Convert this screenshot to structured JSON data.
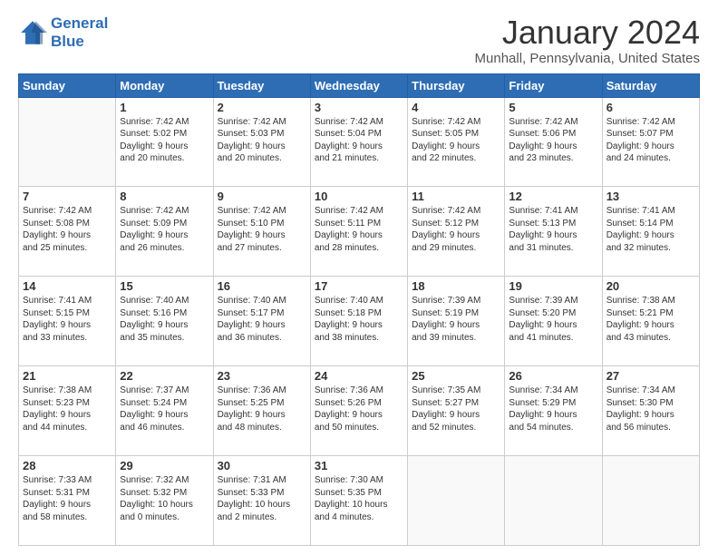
{
  "logo": {
    "line1": "General",
    "line2": "Blue"
  },
  "title": "January 2024",
  "subtitle": "Munhall, Pennsylvania, United States",
  "headers": [
    "Sunday",
    "Monday",
    "Tuesday",
    "Wednesday",
    "Thursday",
    "Friday",
    "Saturday"
  ],
  "weeks": [
    [
      {
        "day": "",
        "lines": []
      },
      {
        "day": "1",
        "lines": [
          "Sunrise: 7:42 AM",
          "Sunset: 5:02 PM",
          "Daylight: 9 hours",
          "and 20 minutes."
        ]
      },
      {
        "day": "2",
        "lines": [
          "Sunrise: 7:42 AM",
          "Sunset: 5:03 PM",
          "Daylight: 9 hours",
          "and 20 minutes."
        ]
      },
      {
        "day": "3",
        "lines": [
          "Sunrise: 7:42 AM",
          "Sunset: 5:04 PM",
          "Daylight: 9 hours",
          "and 21 minutes."
        ]
      },
      {
        "day": "4",
        "lines": [
          "Sunrise: 7:42 AM",
          "Sunset: 5:05 PM",
          "Daylight: 9 hours",
          "and 22 minutes."
        ]
      },
      {
        "day": "5",
        "lines": [
          "Sunrise: 7:42 AM",
          "Sunset: 5:06 PM",
          "Daylight: 9 hours",
          "and 23 minutes."
        ]
      },
      {
        "day": "6",
        "lines": [
          "Sunrise: 7:42 AM",
          "Sunset: 5:07 PM",
          "Daylight: 9 hours",
          "and 24 minutes."
        ]
      }
    ],
    [
      {
        "day": "7",
        "lines": [
          "Sunrise: 7:42 AM",
          "Sunset: 5:08 PM",
          "Daylight: 9 hours",
          "and 25 minutes."
        ]
      },
      {
        "day": "8",
        "lines": [
          "Sunrise: 7:42 AM",
          "Sunset: 5:09 PM",
          "Daylight: 9 hours",
          "and 26 minutes."
        ]
      },
      {
        "day": "9",
        "lines": [
          "Sunrise: 7:42 AM",
          "Sunset: 5:10 PM",
          "Daylight: 9 hours",
          "and 27 minutes."
        ]
      },
      {
        "day": "10",
        "lines": [
          "Sunrise: 7:42 AM",
          "Sunset: 5:11 PM",
          "Daylight: 9 hours",
          "and 28 minutes."
        ]
      },
      {
        "day": "11",
        "lines": [
          "Sunrise: 7:42 AM",
          "Sunset: 5:12 PM",
          "Daylight: 9 hours",
          "and 29 minutes."
        ]
      },
      {
        "day": "12",
        "lines": [
          "Sunrise: 7:41 AM",
          "Sunset: 5:13 PM",
          "Daylight: 9 hours",
          "and 31 minutes."
        ]
      },
      {
        "day": "13",
        "lines": [
          "Sunrise: 7:41 AM",
          "Sunset: 5:14 PM",
          "Daylight: 9 hours",
          "and 32 minutes."
        ]
      }
    ],
    [
      {
        "day": "14",
        "lines": [
          "Sunrise: 7:41 AM",
          "Sunset: 5:15 PM",
          "Daylight: 9 hours",
          "and 33 minutes."
        ]
      },
      {
        "day": "15",
        "lines": [
          "Sunrise: 7:40 AM",
          "Sunset: 5:16 PM",
          "Daylight: 9 hours",
          "and 35 minutes."
        ]
      },
      {
        "day": "16",
        "lines": [
          "Sunrise: 7:40 AM",
          "Sunset: 5:17 PM",
          "Daylight: 9 hours",
          "and 36 minutes."
        ]
      },
      {
        "day": "17",
        "lines": [
          "Sunrise: 7:40 AM",
          "Sunset: 5:18 PM",
          "Daylight: 9 hours",
          "and 38 minutes."
        ]
      },
      {
        "day": "18",
        "lines": [
          "Sunrise: 7:39 AM",
          "Sunset: 5:19 PM",
          "Daylight: 9 hours",
          "and 39 minutes."
        ]
      },
      {
        "day": "19",
        "lines": [
          "Sunrise: 7:39 AM",
          "Sunset: 5:20 PM",
          "Daylight: 9 hours",
          "and 41 minutes."
        ]
      },
      {
        "day": "20",
        "lines": [
          "Sunrise: 7:38 AM",
          "Sunset: 5:21 PM",
          "Daylight: 9 hours",
          "and 43 minutes."
        ]
      }
    ],
    [
      {
        "day": "21",
        "lines": [
          "Sunrise: 7:38 AM",
          "Sunset: 5:23 PM",
          "Daylight: 9 hours",
          "and 44 minutes."
        ]
      },
      {
        "day": "22",
        "lines": [
          "Sunrise: 7:37 AM",
          "Sunset: 5:24 PM",
          "Daylight: 9 hours",
          "and 46 minutes."
        ]
      },
      {
        "day": "23",
        "lines": [
          "Sunrise: 7:36 AM",
          "Sunset: 5:25 PM",
          "Daylight: 9 hours",
          "and 48 minutes."
        ]
      },
      {
        "day": "24",
        "lines": [
          "Sunrise: 7:36 AM",
          "Sunset: 5:26 PM",
          "Daylight: 9 hours",
          "and 50 minutes."
        ]
      },
      {
        "day": "25",
        "lines": [
          "Sunrise: 7:35 AM",
          "Sunset: 5:27 PM",
          "Daylight: 9 hours",
          "and 52 minutes."
        ]
      },
      {
        "day": "26",
        "lines": [
          "Sunrise: 7:34 AM",
          "Sunset: 5:29 PM",
          "Daylight: 9 hours",
          "and 54 minutes."
        ]
      },
      {
        "day": "27",
        "lines": [
          "Sunrise: 7:34 AM",
          "Sunset: 5:30 PM",
          "Daylight: 9 hours",
          "and 56 minutes."
        ]
      }
    ],
    [
      {
        "day": "28",
        "lines": [
          "Sunrise: 7:33 AM",
          "Sunset: 5:31 PM",
          "Daylight: 9 hours",
          "and 58 minutes."
        ]
      },
      {
        "day": "29",
        "lines": [
          "Sunrise: 7:32 AM",
          "Sunset: 5:32 PM",
          "Daylight: 10 hours",
          "and 0 minutes."
        ]
      },
      {
        "day": "30",
        "lines": [
          "Sunrise: 7:31 AM",
          "Sunset: 5:33 PM",
          "Daylight: 10 hours",
          "and 2 minutes."
        ]
      },
      {
        "day": "31",
        "lines": [
          "Sunrise: 7:30 AM",
          "Sunset: 5:35 PM",
          "Daylight: 10 hours",
          "and 4 minutes."
        ]
      },
      {
        "day": "",
        "lines": []
      },
      {
        "day": "",
        "lines": []
      },
      {
        "day": "",
        "lines": []
      }
    ]
  ]
}
